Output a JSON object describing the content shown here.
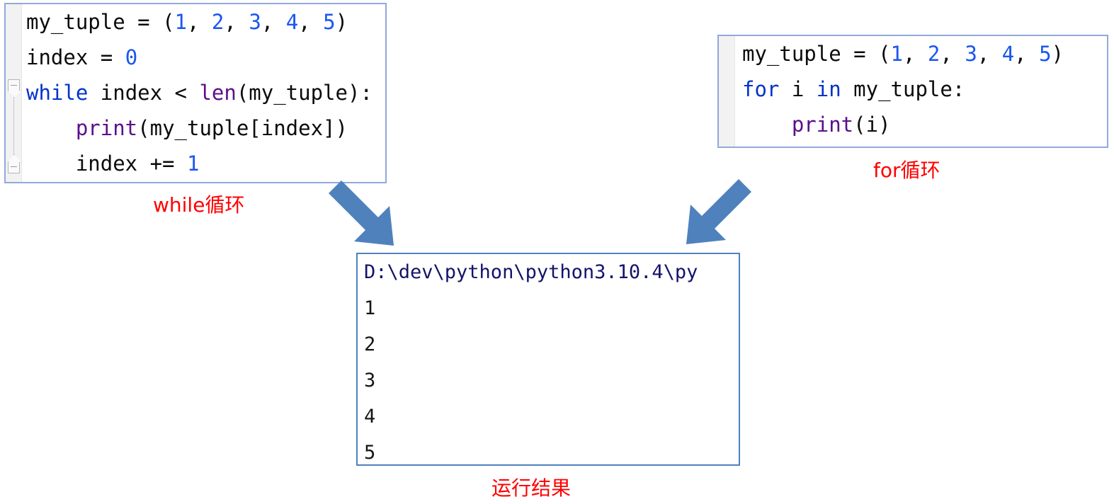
{
  "while_block": {
    "title": "while-loop-code",
    "lines": [
      [
        {
          "t": "my_tuple = ",
          "c": "tok-plain"
        },
        {
          "t": "(",
          "c": "tok-plain"
        },
        {
          "t": "1",
          "c": "tok-num"
        },
        {
          "t": ", ",
          "c": "tok-plain"
        },
        {
          "t": "2",
          "c": "tok-num"
        },
        {
          "t": ", ",
          "c": "tok-plain"
        },
        {
          "t": "3",
          "c": "tok-num"
        },
        {
          "t": ", ",
          "c": "tok-plain"
        },
        {
          "t": "4",
          "c": "tok-num"
        },
        {
          "t": ", ",
          "c": "tok-plain"
        },
        {
          "t": "5",
          "c": "tok-num"
        },
        {
          "t": ")",
          "c": "tok-plain"
        }
      ],
      [
        {
          "t": "index = ",
          "c": "tok-plain"
        },
        {
          "t": "0",
          "c": "tok-num"
        }
      ],
      [
        {
          "t": "while",
          "c": "tok-kw"
        },
        {
          "t": " index < ",
          "c": "tok-plain"
        },
        {
          "t": "len",
          "c": "tok-fn"
        },
        {
          "t": "(my_tuple):",
          "c": "tok-plain"
        }
      ],
      [
        {
          "t": "    ",
          "c": "tok-plain"
        },
        {
          "t": "print",
          "c": "tok-fn"
        },
        {
          "t": "(my_tuple[index])",
          "c": "tok-plain"
        }
      ],
      [
        {
          "t": "    index += ",
          "c": "tok-plain"
        },
        {
          "t": "1",
          "c": "tok-num"
        }
      ]
    ]
  },
  "for_block": {
    "title": "for-loop-code",
    "lines": [
      [
        {
          "t": "my_tuple = ",
          "c": "tok-plain"
        },
        {
          "t": "(",
          "c": "tok-plain"
        },
        {
          "t": "1",
          "c": "tok-num"
        },
        {
          "t": ", ",
          "c": "tok-plain"
        },
        {
          "t": "2",
          "c": "tok-num"
        },
        {
          "t": ", ",
          "c": "tok-plain"
        },
        {
          "t": "3",
          "c": "tok-num"
        },
        {
          "t": ", ",
          "c": "tok-plain"
        },
        {
          "t": "4",
          "c": "tok-num"
        },
        {
          "t": ", ",
          "c": "tok-plain"
        },
        {
          "t": "5",
          "c": "tok-num"
        },
        {
          "t": ")",
          "c": "tok-plain"
        }
      ],
      [
        {
          "t": "for",
          "c": "tok-kw"
        },
        {
          "t": " i ",
          "c": "tok-plain"
        },
        {
          "t": "in",
          "c": "tok-kw"
        },
        {
          "t": " my_tuple:",
          "c": "tok-plain"
        }
      ],
      [
        {
          "t": "    ",
          "c": "tok-plain"
        },
        {
          "t": "print",
          "c": "tok-fn"
        },
        {
          "t": "(i)",
          "c": "tok-plain"
        }
      ]
    ]
  },
  "output_block": {
    "title": "run-output",
    "command_line": "D:\\dev\\python\\python3.10.4\\py",
    "values": [
      "1",
      "2",
      "3",
      "4",
      "5"
    ]
  },
  "labels": {
    "while_label": "while循环",
    "for_label": "for循环",
    "run_label": "运行结果"
  },
  "colors": {
    "arrow_blue": "#4f81bd",
    "panel_border": "#8faadc",
    "output_border": "#4f81bd",
    "label_red": "#ff0000",
    "keyword_blue": "#0033cc",
    "number_blue": "#1a56f0",
    "builtin_purple": "#5b0f8c",
    "output_path_navy": "#13136b"
  }
}
